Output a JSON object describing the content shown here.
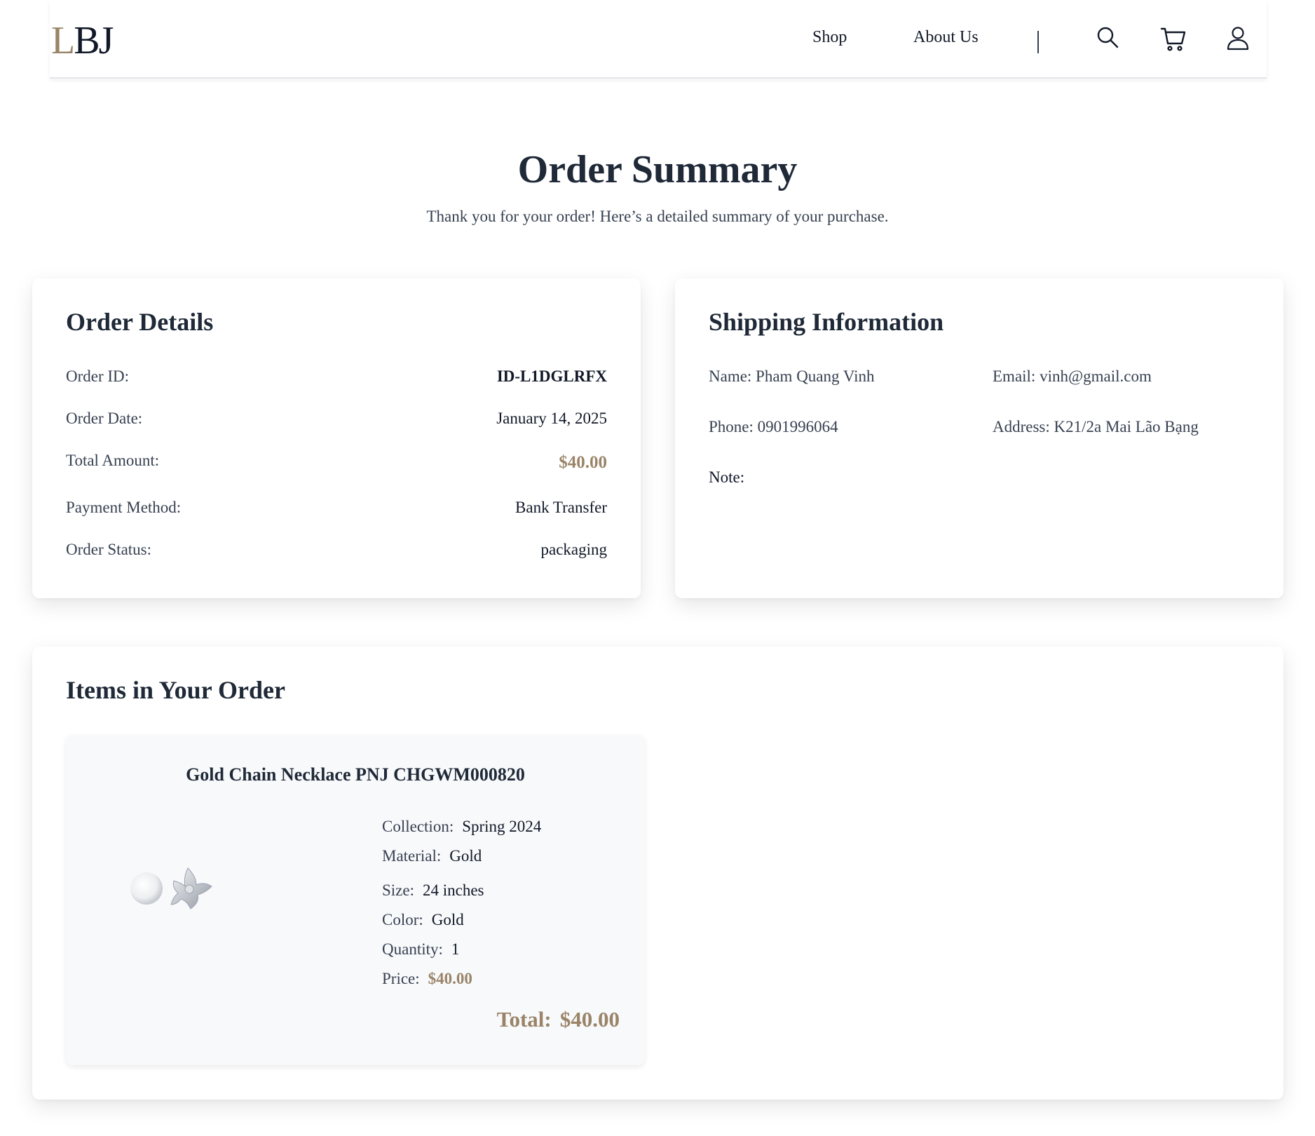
{
  "nav": {
    "logo_l": "L",
    "logo_bj": "BJ",
    "links": [
      "Shop",
      "About Us"
    ],
    "icons": [
      "search-icon",
      "cart-icon",
      "user-icon"
    ]
  },
  "header": {
    "title": "Order Summary",
    "subtitle": "Thank you for your order! Here’s a detailed summary of your purchase."
  },
  "order_details": {
    "title": "Order Details",
    "rows": [
      {
        "label": "Order ID:",
        "value": "ID-L1DGLRFX"
      },
      {
        "label": "Order Date:",
        "value": "January 14, 2025"
      },
      {
        "label": "Total Amount:",
        "value": "$40.00"
      },
      {
        "label": "Payment Method:",
        "value": "Bank Transfer"
      },
      {
        "label": "Order Status:",
        "value": "packaging"
      }
    ]
  },
  "shipping": {
    "title": "Shipping Information",
    "name": "Name: Pham Quang Vinh",
    "email": "Email: vinh@gmail.com",
    "phone": "Phone: 0901996064",
    "address": "Address: K21/2a Mai Lão Bạng",
    "note": "Note:"
  },
  "items": {
    "title": "Items in Your Order",
    "list": [
      {
        "name": "Gold Chain Necklace PNJ CHGWM000820",
        "attributes": [
          {
            "label": "Collection:",
            "value": "Spring 2024"
          },
          {
            "label": "Material:",
            "value": "Gold"
          },
          {
            "label": "Size:",
            "value": "24 inches"
          },
          {
            "label": "Color:",
            "value": "Gold"
          },
          {
            "label": "Quantity:",
            "value": "1"
          },
          {
            "label": "Price:",
            "value": "$40.00"
          }
        ],
        "total_label": "Total:",
        "total_value": "$40.00"
      }
    ]
  },
  "colors": {
    "accent_gold": "#9a8468",
    "text_dark": "#1f2937",
    "card_bg": "#f8f9fb"
  }
}
